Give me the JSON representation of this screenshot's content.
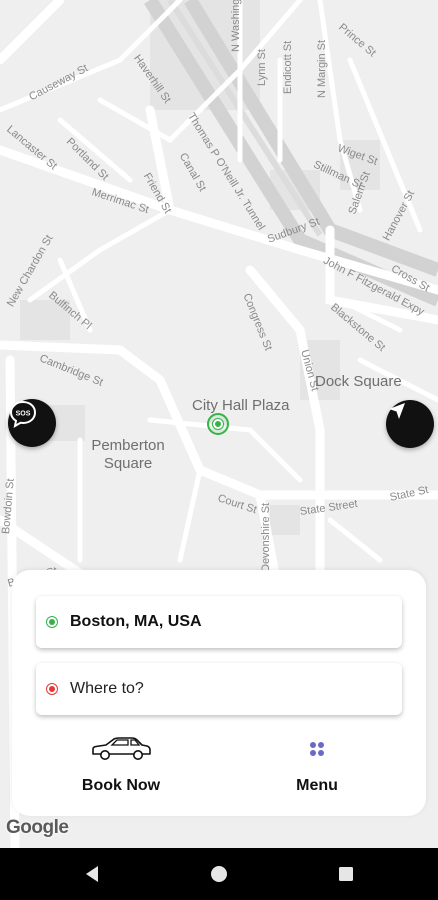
{
  "map": {
    "streets": [
      {
        "id": "causeway",
        "text": "Causeway St"
      },
      {
        "id": "lancaster",
        "text": "Lancaster St"
      },
      {
        "id": "portland",
        "text": "Portland St"
      },
      {
        "id": "haverhill",
        "text": "Haverhill St"
      },
      {
        "id": "thomas",
        "text": "Thomas P O'Neill Jr. Tunnel"
      },
      {
        "id": "nwashington",
        "text": "N Washington St"
      },
      {
        "id": "lynn",
        "text": "Lynn St"
      },
      {
        "id": "endicott",
        "text": "Endicott St"
      },
      {
        "id": "nmargin",
        "text": "N Margin St"
      },
      {
        "id": "prince",
        "text": "Prince St"
      },
      {
        "id": "wiget",
        "text": "Wiget St"
      },
      {
        "id": "stillman",
        "text": "Stillman St"
      },
      {
        "id": "salem",
        "text": "Salem St"
      },
      {
        "id": "hanover",
        "text": "Hanover St"
      },
      {
        "id": "canal",
        "text": "Canal St"
      },
      {
        "id": "friend",
        "text": "Friend St"
      },
      {
        "id": "merrimac",
        "text": "Merrimac St"
      },
      {
        "id": "sudbury",
        "text": "Sudbury St"
      },
      {
        "id": "johnf",
        "text": "John F Fitzgerald Expy"
      },
      {
        "id": "cross",
        "text": "Cross St"
      },
      {
        "id": "nchardon",
        "text": "New Chardon St"
      },
      {
        "id": "bulfinch",
        "text": "Bulfinch Pl"
      },
      {
        "id": "congress",
        "text": "Congress St"
      },
      {
        "id": "blackstone",
        "text": "Blackstone St"
      },
      {
        "id": "union",
        "text": "Union St"
      },
      {
        "id": "cambridge",
        "text": "Cambridge St"
      },
      {
        "id": "court",
        "text": "Court St"
      },
      {
        "id": "statestreet",
        "text": "State Street"
      },
      {
        "id": "statest",
        "text": "State St"
      },
      {
        "id": "bowdoin",
        "text": "Bowdoin St"
      },
      {
        "id": "beacon",
        "text": "Beacon St"
      },
      {
        "id": "devonshire",
        "text": "Devonshire St"
      }
    ],
    "places": {
      "city_hall_plaza": "City Hall Plaza",
      "dock_square": "Dock Square",
      "pemberton_line1": "Pemberton",
      "pemberton_line2": "Square"
    },
    "attribution": "Google"
  },
  "buttons": {
    "sos_label": "SOS",
    "sos_icon": "sos-chat-icon",
    "locate_icon": "navigation-arrow-icon"
  },
  "pickup": {
    "value": "Boston, MA, USA",
    "icon": "pickup-dot-icon",
    "color": "#35b34a"
  },
  "destination": {
    "placeholder": "Where to?",
    "icon": "destination-dot-icon",
    "color": "#e53935"
  },
  "actions": {
    "book_label": "Book Now",
    "book_icon": "car-icon",
    "menu_label": "Menu",
    "menu_icon": "grid-dots-icon",
    "menu_icon_color": "#6a68c9"
  },
  "navbar": {
    "back_icon": "back-triangle-icon",
    "home_icon": "home-circle-icon",
    "recents_icon": "recents-square-icon"
  }
}
